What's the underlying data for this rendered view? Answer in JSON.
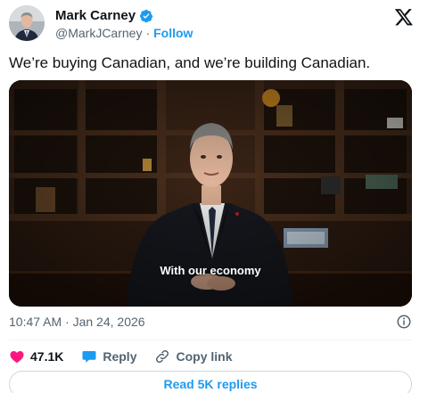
{
  "author": {
    "name": "Mark Carney",
    "handle": "@MarkJCarney",
    "separator": "·",
    "follow_label": "Follow",
    "verified_color": "#1d9bf0"
  },
  "tweet": {
    "text": "We’re buying Canadian, and we’re building Canadian."
  },
  "media": {
    "type": "video",
    "caption": "With our economy"
  },
  "meta": {
    "timestamp": "10:47 AM · Jan 24, 2026"
  },
  "actions": {
    "likes": "47.1K",
    "reply_label": "Reply",
    "copy_link_label": "Copy link"
  },
  "footer": {
    "read_replies_label": "Read 5K replies"
  },
  "colors": {
    "accent": "#1d9bf0",
    "like": "#f91880",
    "text": "#0f1419",
    "muted": "#536471"
  }
}
